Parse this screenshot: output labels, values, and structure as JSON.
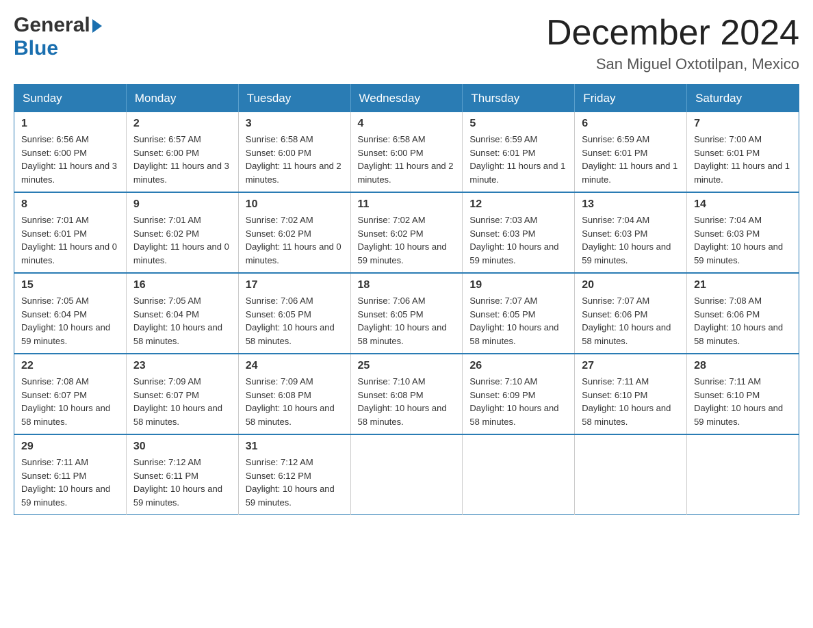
{
  "logo": {
    "general": "General",
    "blue": "Blue"
  },
  "header": {
    "month_year": "December 2024",
    "location": "San Miguel Oxtotilpan, Mexico"
  },
  "days_of_week": [
    "Sunday",
    "Monday",
    "Tuesday",
    "Wednesday",
    "Thursday",
    "Friday",
    "Saturday"
  ],
  "weeks": [
    [
      {
        "day": "1",
        "sunrise": "Sunrise: 6:56 AM",
        "sunset": "Sunset: 6:00 PM",
        "daylight": "Daylight: 11 hours and 3 minutes."
      },
      {
        "day": "2",
        "sunrise": "Sunrise: 6:57 AM",
        "sunset": "Sunset: 6:00 PM",
        "daylight": "Daylight: 11 hours and 3 minutes."
      },
      {
        "day": "3",
        "sunrise": "Sunrise: 6:58 AM",
        "sunset": "Sunset: 6:00 PM",
        "daylight": "Daylight: 11 hours and 2 minutes."
      },
      {
        "day": "4",
        "sunrise": "Sunrise: 6:58 AM",
        "sunset": "Sunset: 6:00 PM",
        "daylight": "Daylight: 11 hours and 2 minutes."
      },
      {
        "day": "5",
        "sunrise": "Sunrise: 6:59 AM",
        "sunset": "Sunset: 6:01 PM",
        "daylight": "Daylight: 11 hours and 1 minute."
      },
      {
        "day": "6",
        "sunrise": "Sunrise: 6:59 AM",
        "sunset": "Sunset: 6:01 PM",
        "daylight": "Daylight: 11 hours and 1 minute."
      },
      {
        "day": "7",
        "sunrise": "Sunrise: 7:00 AM",
        "sunset": "Sunset: 6:01 PM",
        "daylight": "Daylight: 11 hours and 1 minute."
      }
    ],
    [
      {
        "day": "8",
        "sunrise": "Sunrise: 7:01 AM",
        "sunset": "Sunset: 6:01 PM",
        "daylight": "Daylight: 11 hours and 0 minutes."
      },
      {
        "day": "9",
        "sunrise": "Sunrise: 7:01 AM",
        "sunset": "Sunset: 6:02 PM",
        "daylight": "Daylight: 11 hours and 0 minutes."
      },
      {
        "day": "10",
        "sunrise": "Sunrise: 7:02 AM",
        "sunset": "Sunset: 6:02 PM",
        "daylight": "Daylight: 11 hours and 0 minutes."
      },
      {
        "day": "11",
        "sunrise": "Sunrise: 7:02 AM",
        "sunset": "Sunset: 6:02 PM",
        "daylight": "Daylight: 10 hours and 59 minutes."
      },
      {
        "day": "12",
        "sunrise": "Sunrise: 7:03 AM",
        "sunset": "Sunset: 6:03 PM",
        "daylight": "Daylight: 10 hours and 59 minutes."
      },
      {
        "day": "13",
        "sunrise": "Sunrise: 7:04 AM",
        "sunset": "Sunset: 6:03 PM",
        "daylight": "Daylight: 10 hours and 59 minutes."
      },
      {
        "day": "14",
        "sunrise": "Sunrise: 7:04 AM",
        "sunset": "Sunset: 6:03 PM",
        "daylight": "Daylight: 10 hours and 59 minutes."
      }
    ],
    [
      {
        "day": "15",
        "sunrise": "Sunrise: 7:05 AM",
        "sunset": "Sunset: 6:04 PM",
        "daylight": "Daylight: 10 hours and 59 minutes."
      },
      {
        "day": "16",
        "sunrise": "Sunrise: 7:05 AM",
        "sunset": "Sunset: 6:04 PM",
        "daylight": "Daylight: 10 hours and 58 minutes."
      },
      {
        "day": "17",
        "sunrise": "Sunrise: 7:06 AM",
        "sunset": "Sunset: 6:05 PM",
        "daylight": "Daylight: 10 hours and 58 minutes."
      },
      {
        "day": "18",
        "sunrise": "Sunrise: 7:06 AM",
        "sunset": "Sunset: 6:05 PM",
        "daylight": "Daylight: 10 hours and 58 minutes."
      },
      {
        "day": "19",
        "sunrise": "Sunrise: 7:07 AM",
        "sunset": "Sunset: 6:05 PM",
        "daylight": "Daylight: 10 hours and 58 minutes."
      },
      {
        "day": "20",
        "sunrise": "Sunrise: 7:07 AM",
        "sunset": "Sunset: 6:06 PM",
        "daylight": "Daylight: 10 hours and 58 minutes."
      },
      {
        "day": "21",
        "sunrise": "Sunrise: 7:08 AM",
        "sunset": "Sunset: 6:06 PM",
        "daylight": "Daylight: 10 hours and 58 minutes."
      }
    ],
    [
      {
        "day": "22",
        "sunrise": "Sunrise: 7:08 AM",
        "sunset": "Sunset: 6:07 PM",
        "daylight": "Daylight: 10 hours and 58 minutes."
      },
      {
        "day": "23",
        "sunrise": "Sunrise: 7:09 AM",
        "sunset": "Sunset: 6:07 PM",
        "daylight": "Daylight: 10 hours and 58 minutes."
      },
      {
        "day": "24",
        "sunrise": "Sunrise: 7:09 AM",
        "sunset": "Sunset: 6:08 PM",
        "daylight": "Daylight: 10 hours and 58 minutes."
      },
      {
        "day": "25",
        "sunrise": "Sunrise: 7:10 AM",
        "sunset": "Sunset: 6:08 PM",
        "daylight": "Daylight: 10 hours and 58 minutes."
      },
      {
        "day": "26",
        "sunrise": "Sunrise: 7:10 AM",
        "sunset": "Sunset: 6:09 PM",
        "daylight": "Daylight: 10 hours and 58 minutes."
      },
      {
        "day": "27",
        "sunrise": "Sunrise: 7:11 AM",
        "sunset": "Sunset: 6:10 PM",
        "daylight": "Daylight: 10 hours and 58 minutes."
      },
      {
        "day": "28",
        "sunrise": "Sunrise: 7:11 AM",
        "sunset": "Sunset: 6:10 PM",
        "daylight": "Daylight: 10 hours and 59 minutes."
      }
    ],
    [
      {
        "day": "29",
        "sunrise": "Sunrise: 7:11 AM",
        "sunset": "Sunset: 6:11 PM",
        "daylight": "Daylight: 10 hours and 59 minutes."
      },
      {
        "day": "30",
        "sunrise": "Sunrise: 7:12 AM",
        "sunset": "Sunset: 6:11 PM",
        "daylight": "Daylight: 10 hours and 59 minutes."
      },
      {
        "day": "31",
        "sunrise": "Sunrise: 7:12 AM",
        "sunset": "Sunset: 6:12 PM",
        "daylight": "Daylight: 10 hours and 59 minutes."
      },
      null,
      null,
      null,
      null
    ]
  ]
}
